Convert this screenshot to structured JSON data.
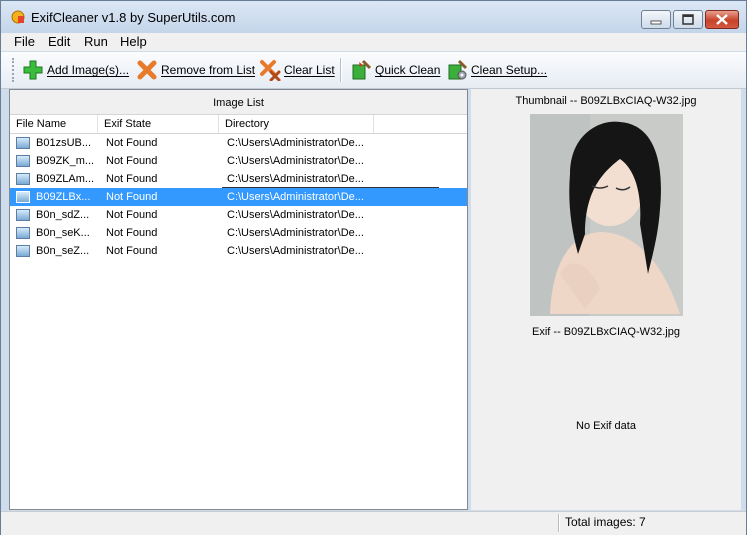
{
  "window": {
    "title": "ExifCleaner v1.8 by SuperUtils.com"
  },
  "menu": [
    "File",
    "Edit",
    "Run",
    "Help"
  ],
  "toolbar": {
    "add": "Add Image(s)...",
    "remove": "Remove from List",
    "clear": "Clear List",
    "quick": "Quick Clean",
    "setup": "Clean Setup..."
  },
  "image_list": {
    "caption": "Image List",
    "columns": [
      "File Name",
      "Exif State",
      "Directory"
    ],
    "rows": [
      {
        "name": "B01zsUB...",
        "state": "Not Found",
        "dir": "C:\\Users\\Administrator\\De..."
      },
      {
        "name": "B09ZK_m...",
        "state": "Not Found",
        "dir": "C:\\Users\\Administrator\\De..."
      },
      {
        "name": "B09ZLAm...",
        "state": "Not Found",
        "dir": "C:\\Users\\Administrator\\De..."
      },
      {
        "name": "B09ZLBx...",
        "state": "Not Found",
        "dir": "C:\\Users\\Administrator\\De..."
      },
      {
        "name": "B0n_sdZ...",
        "state": "Not Found",
        "dir": "C:\\Users\\Administrator\\De..."
      },
      {
        "name": "B0n_seK...",
        "state": "Not Found",
        "dir": "C:\\Users\\Administrator\\De..."
      },
      {
        "name": "B0n_seZ...",
        "state": "Not Found",
        "dir": "C:\\Users\\Administrator\\De..."
      }
    ],
    "selected_index": 3
  },
  "preview": {
    "thumbnail_caption": "Thumbnail -- B09ZLBxCIAQ-W32.jpg",
    "exif_caption": "Exif -- B09ZLBxCIAQ-W32.jpg",
    "exif_body": "No Exif data"
  },
  "status": {
    "total": "Total images: 7"
  },
  "colors": {
    "selection": "#3399ff",
    "title_bg": "#c4d5ea"
  },
  "icons": [
    "app-icon",
    "add-image-icon",
    "remove-icon",
    "clear-list-icon",
    "quick-clean-icon",
    "clean-setup-icon",
    "image-file-icon"
  ]
}
